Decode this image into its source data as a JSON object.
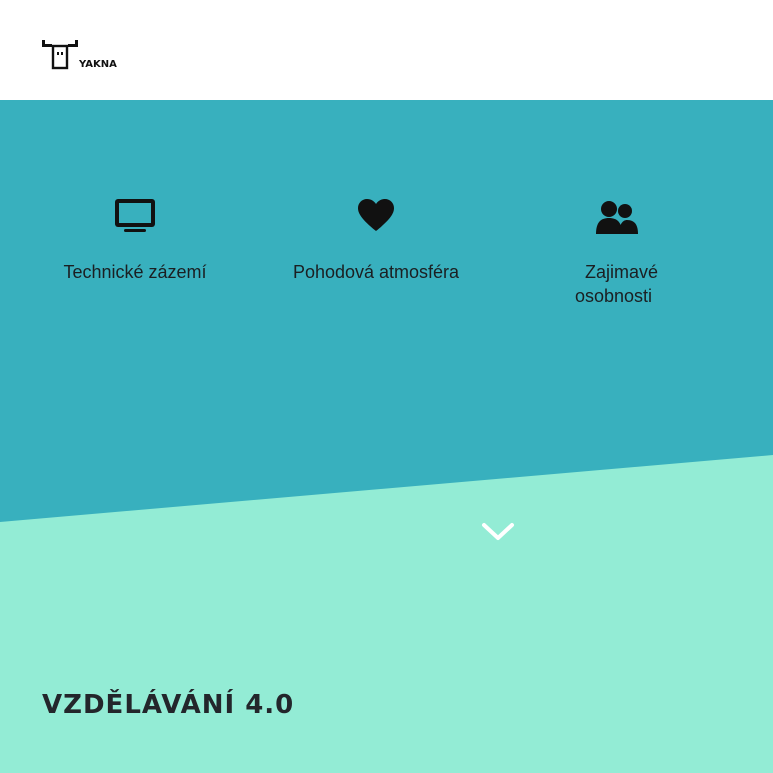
{
  "header": {
    "logo_text": "YAKNA",
    "logo_icon": "moose-icon"
  },
  "features": [
    {
      "icon": "monitor-icon",
      "label": "Technické zázemí"
    },
    {
      "icon": "heart-icon",
      "label": "Pohodová atmosféra"
    },
    {
      "icon": "people-icon",
      "label_line1": "Zajimavé",
      "label_line2": "osobnosti"
    }
  ],
  "scroll_icon": "chevron-down-icon",
  "section": {
    "title": "VZDĚLÁVÁNÍ 4.0"
  },
  "colors": {
    "header_bg": "#ffffff",
    "hero_bg": "#38b0be",
    "lower_bg": "#93ecd5",
    "text_dark": "#1b1f22"
  }
}
